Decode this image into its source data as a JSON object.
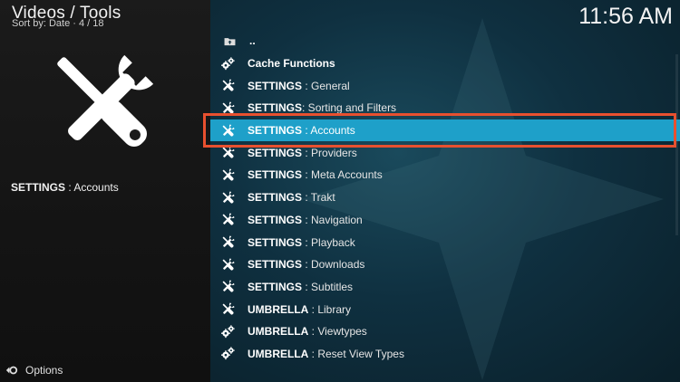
{
  "header": {
    "title": "Videos / Tools",
    "subtitle": "Sort by: Date  ·  4 / 18",
    "clock": "11:56 AM"
  },
  "sidebar": {
    "selected_label_bold": "SETTINGS",
    "selected_label_rest": " : Accounts",
    "options_label": "Options"
  },
  "list": {
    "items": [
      {
        "icon": "folder-up-icon",
        "bold": "..",
        "rest": ""
      },
      {
        "icon": "gears-icon",
        "bold": "Cache Functions",
        "rest": ""
      },
      {
        "icon": "tools-icon",
        "bold": "SETTINGS",
        "rest": " : General"
      },
      {
        "icon": "tools-icon",
        "bold": "SETTINGS",
        "rest": ": Sorting and Filters"
      },
      {
        "icon": "tools-icon",
        "bold": "SETTINGS",
        "rest": " : Accounts"
      },
      {
        "icon": "tools-icon",
        "bold": "SETTINGS",
        "rest": " : Providers"
      },
      {
        "icon": "tools-icon",
        "bold": "SETTINGS",
        "rest": " : Meta Accounts"
      },
      {
        "icon": "tools-icon",
        "bold": "SETTINGS",
        "rest": " : Trakt"
      },
      {
        "icon": "tools-icon",
        "bold": "SETTINGS",
        "rest": " : Navigation"
      },
      {
        "icon": "tools-icon",
        "bold": "SETTINGS",
        "rest": " : Playback"
      },
      {
        "icon": "tools-icon",
        "bold": "SETTINGS",
        "rest": " : Downloads"
      },
      {
        "icon": "tools-icon",
        "bold": "SETTINGS",
        "rest": " : Subtitles"
      },
      {
        "icon": "tools-icon",
        "bold": "UMBRELLA",
        "rest": " : Library"
      },
      {
        "icon": "gears-icon",
        "bold": "UMBRELLA",
        "rest": " : Viewtypes"
      },
      {
        "icon": "gears-icon",
        "bold": "UMBRELLA",
        "rest": " : Reset View Types"
      }
    ],
    "selected_index": 4
  },
  "colors": {
    "selection": "#1ea0c9",
    "highlight_border": "#e8502f"
  }
}
